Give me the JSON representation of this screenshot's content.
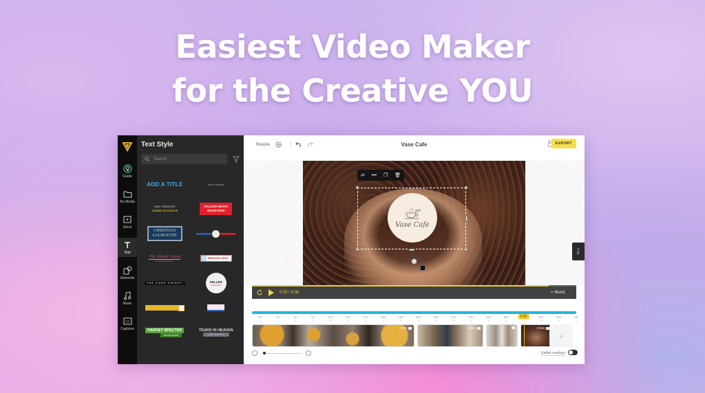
{
  "hero": {
    "line1": "Easiest Video Maker",
    "line2": "for the Creative YOU"
  },
  "rail": {
    "items": [
      {
        "label": "Guide",
        "icon": "lightbulb-icon"
      },
      {
        "label": "My Media",
        "icon": "folder-icon"
      },
      {
        "label": "Stock",
        "icon": "stock-video-icon"
      },
      {
        "label": "Text",
        "icon": "text-icon",
        "active": true
      },
      {
        "label": "Elements",
        "icon": "shapes-icon"
      },
      {
        "label": "Music",
        "icon": "music-note-icon"
      },
      {
        "label": "Captions",
        "icon": "cc-icon"
      }
    ]
  },
  "panel": {
    "title": "Text Style",
    "search_placeholder": "Search",
    "styles": {
      "add_title": "ADD A TITLE",
      "add_subtitle": "Add a subtitle",
      "small_line1": "ONE TRAVELER",
      "small_line2": "CORED OUTDOPLE",
      "falcon_1": "FALCON HEAVY",
      "falcon_2": "BOOSTERS",
      "louboutin_1": "CHRISTIAN",
      "louboutin_2": "LOUBOUTIN",
      "blonde": "The Blonde Salad",
      "blonde_sub": "FASHION BLOG",
      "breaking": "BREAKING NEWS",
      "dark_knight": "THE DARK KNIGHT",
      "keller": "KELLER",
      "keller_sub": "WILLIAMS",
      "harvey_1": "HARVEY SPECTER",
      "harvey_2": "LAWYER NIGHT",
      "tears_1": "TEARS IN HEAVEN",
      "tears_2": "ERIC CLAPTON"
    }
  },
  "topbar": {
    "resize_label": "Resize",
    "title": "Vase Cafe",
    "export_label": "EXPORT"
  },
  "canvas": {
    "logo_text": "Vase Cafe",
    "more_label": "•••"
  },
  "help_label": "Help",
  "player": {
    "current_time": "0:32",
    "separator": "/",
    "total_time": "0:35",
    "progress": 0.914,
    "music_label": "+ Music"
  },
  "timeline": {
    "ticks": [
      "2s",
      "4s",
      "6s",
      "8s",
      "10s",
      "12s",
      "14s",
      "16s",
      "18s",
      "20s",
      "22s",
      "24s",
      "26s",
      "28s",
      "30s",
      "0:32",
      "34s",
      "36s",
      "38"
    ],
    "playhead_label": "0:32",
    "clips": [
      {
        "duration": "0:19s"
      },
      {
        "duration": "0:06s"
      },
      {
        "duration": ""
      },
      {
        "duration": "0:04s"
      }
    ],
    "add_label": "+",
    "gather_label": "Gather overlays",
    "gather_enabled": false
  },
  "colors": {
    "accent_yellow": "#f5e04a",
    "timeline_blue": "#1fb6d8",
    "panel_bg": "#282828",
    "rail_bg": "#0d0d0d"
  }
}
